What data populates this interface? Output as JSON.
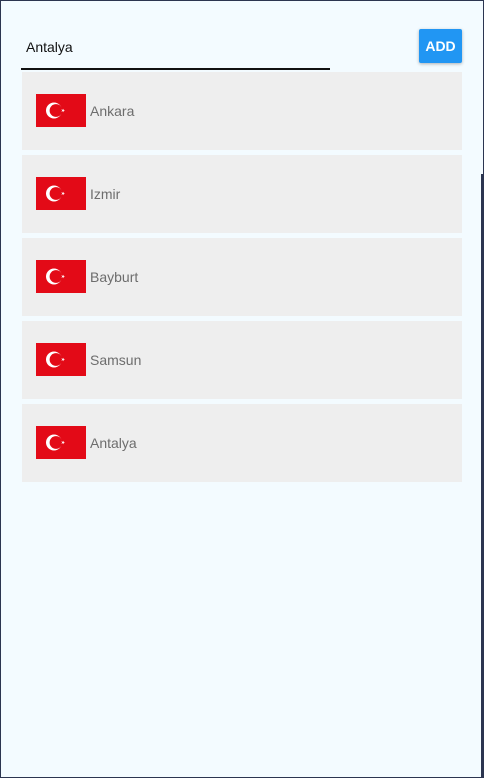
{
  "input": {
    "value": "Antalya",
    "placeholder": ""
  },
  "add_button": {
    "label": "ADD"
  },
  "colors": {
    "accent": "#2196f3",
    "background": "#f3fbff",
    "item_background": "#eeeeee",
    "flag_red": "#e30a17"
  },
  "cities": [
    {
      "name": "Ankara",
      "flag": "turkey-flag-icon"
    },
    {
      "name": "Izmir",
      "flag": "turkey-flag-icon"
    },
    {
      "name": "Bayburt",
      "flag": "turkey-flag-icon"
    },
    {
      "name": "Samsun",
      "flag": "turkey-flag-icon"
    },
    {
      "name": "Antalya",
      "flag": "turkey-flag-icon"
    }
  ]
}
